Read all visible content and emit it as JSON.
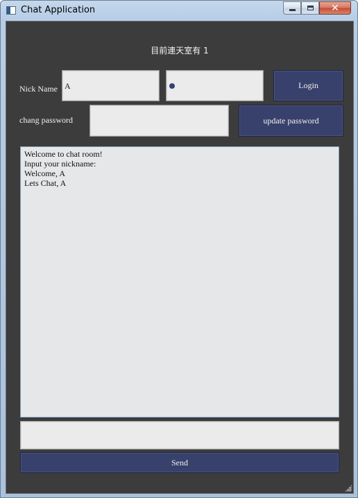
{
  "window": {
    "title": "Chat Application",
    "close_glyph": "✕"
  },
  "header": {
    "online_status": "目前連天室有 1"
  },
  "login": {
    "nick_label": "Nick Name",
    "nick_value": "A",
    "password_value": "●",
    "login_button": "Login"
  },
  "change_password": {
    "label": "chang password",
    "value": "",
    "update_button": "update password"
  },
  "chat": {
    "messages": [
      "Welcome to chat room!",
      "Input your nickname:",
      "Welcome, A",
      "Lets Chat, A"
    ],
    "input_value": "",
    "send_button": "Send"
  },
  "icons": {
    "app": "app-window-icon",
    "minimize": "minimize-icon",
    "maximize": "maximize-icon",
    "close": "close-icon",
    "resize": "resize-grip-icon"
  },
  "colors": {
    "client_background": "#3c3c3c",
    "button": "#37416b",
    "field": "#ebebeb",
    "chat_log": "#e6e7e9"
  }
}
